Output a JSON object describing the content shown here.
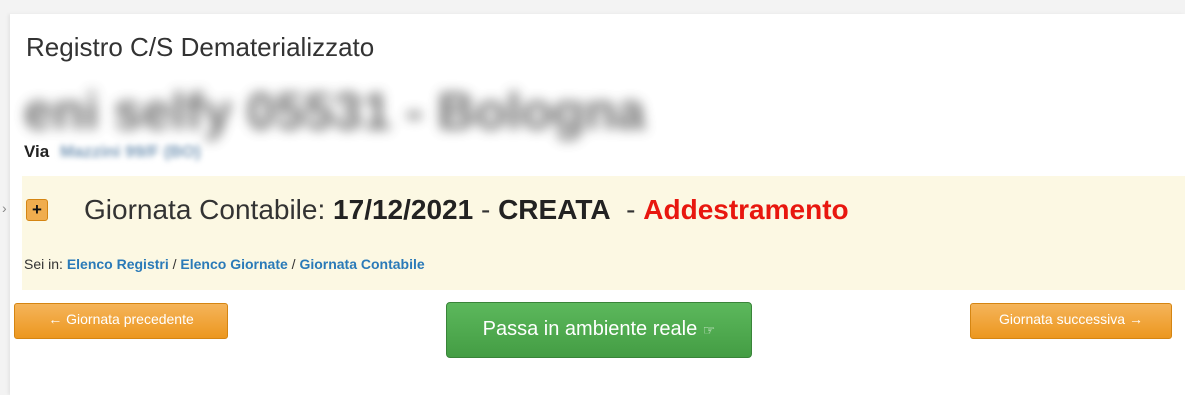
{
  "header": {
    "register_title": "Registro C/S Dematerializzato",
    "station_name": "eni selfy 05531 - Bologna",
    "address_label": "Via",
    "address_value": "Mazzini 99/F (BO)"
  },
  "day": {
    "expand_symbol": "+",
    "label": "Giornata Contabile:",
    "date": "17/12/2021",
    "separator": "-",
    "status": "CREATA",
    "dash": "-",
    "mode": "Addestramento",
    "mode_color": "#e8170f"
  },
  "breadcrumb": {
    "prefix": "Sei in:",
    "items": [
      {
        "label": "Elenco Registri"
      },
      {
        "label": "Elenco Giornate"
      },
      {
        "label": "Giornata Contabile"
      }
    ],
    "separator": "/"
  },
  "actions": {
    "prev_label": "Giornata precedente",
    "prev_arrow": "←",
    "real_label": "Passa in ambiente reale",
    "real_icon": "☞",
    "next_label": "Giornata successiva",
    "next_arrow": "→"
  },
  "colors": {
    "warning": "#f0ad4e",
    "success": "#5cb85c",
    "link": "#2a7ab8",
    "day_box_bg": "#fcf8e3"
  }
}
